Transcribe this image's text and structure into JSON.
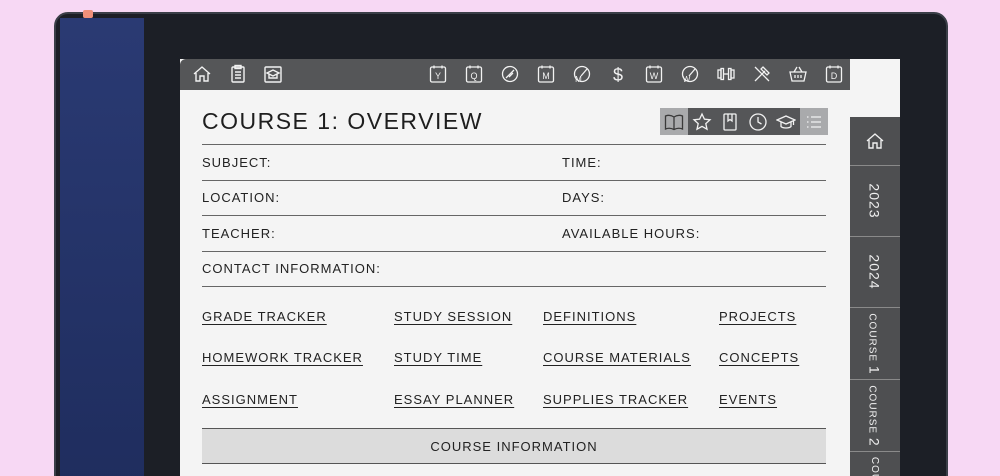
{
  "page": {
    "title": "COURSE 1: OVERVIEW"
  },
  "topbar": {
    "left_icons": [
      "home-icon",
      "clipboard-icon",
      "graduation-cap-icon"
    ],
    "right_icons": [
      {
        "name": "year-icon",
        "label": "Y"
      },
      {
        "name": "quarter-icon",
        "label": "Q"
      },
      {
        "name": "brush-icon",
        "label": ""
      },
      {
        "name": "month-icon",
        "label": "M"
      },
      {
        "name": "monthly-brush-icon",
        "label": "M"
      },
      {
        "name": "dollar-icon",
        "label": "$"
      },
      {
        "name": "week-icon",
        "label": "W"
      },
      {
        "name": "weekly-brush-icon",
        "label": "W"
      },
      {
        "name": "dumbbell-icon",
        "label": ""
      },
      {
        "name": "tools-icon",
        "label": ""
      },
      {
        "name": "basket-icon",
        "label": ""
      },
      {
        "name": "day-icon",
        "label": "D"
      }
    ]
  },
  "toolbar_icons": [
    "book-icon",
    "star-icon",
    "notebook-icon",
    "clock-icon",
    "graduation-cap-icon",
    "list-icon"
  ],
  "fields": {
    "subject": "SUBJECT:",
    "time": "TIME:",
    "location": "LOCATION:",
    "days": "DAYS:",
    "teacher": "TEACHER:",
    "available_hours": "AVAILABLE HOURS:",
    "contact": "CONTACT INFORMATION:"
  },
  "links": {
    "col1": [
      "GRADE TRACKER",
      "HOMEWORK TRACKER",
      "ASSIGNMENT"
    ],
    "col2": [
      "STUDY SESSION",
      "STUDY TIME",
      "ESSAY PLANNER"
    ],
    "col3": [
      "DEFINITIONS",
      "COURSE MATERIALS",
      "SUPPLIES TRACKER"
    ],
    "col4": [
      "PROJECTS",
      "CONCEPTS",
      "EVENTS"
    ]
  },
  "course_info": "COURSE INFORMATION",
  "sidetabs": {
    "y2023": "2023",
    "y2024": "2024",
    "course1_word": "COURSE",
    "course1_num": "1",
    "course2_word": "COURSE",
    "course2_num": "2",
    "course3_word": "COU"
  },
  "colors": {
    "background": "#f7d8f4",
    "topbar": "#555658",
    "sidetabs": "#4e4f51",
    "screen": "#f4f4f4",
    "info_bar": "#dcdcdc"
  }
}
